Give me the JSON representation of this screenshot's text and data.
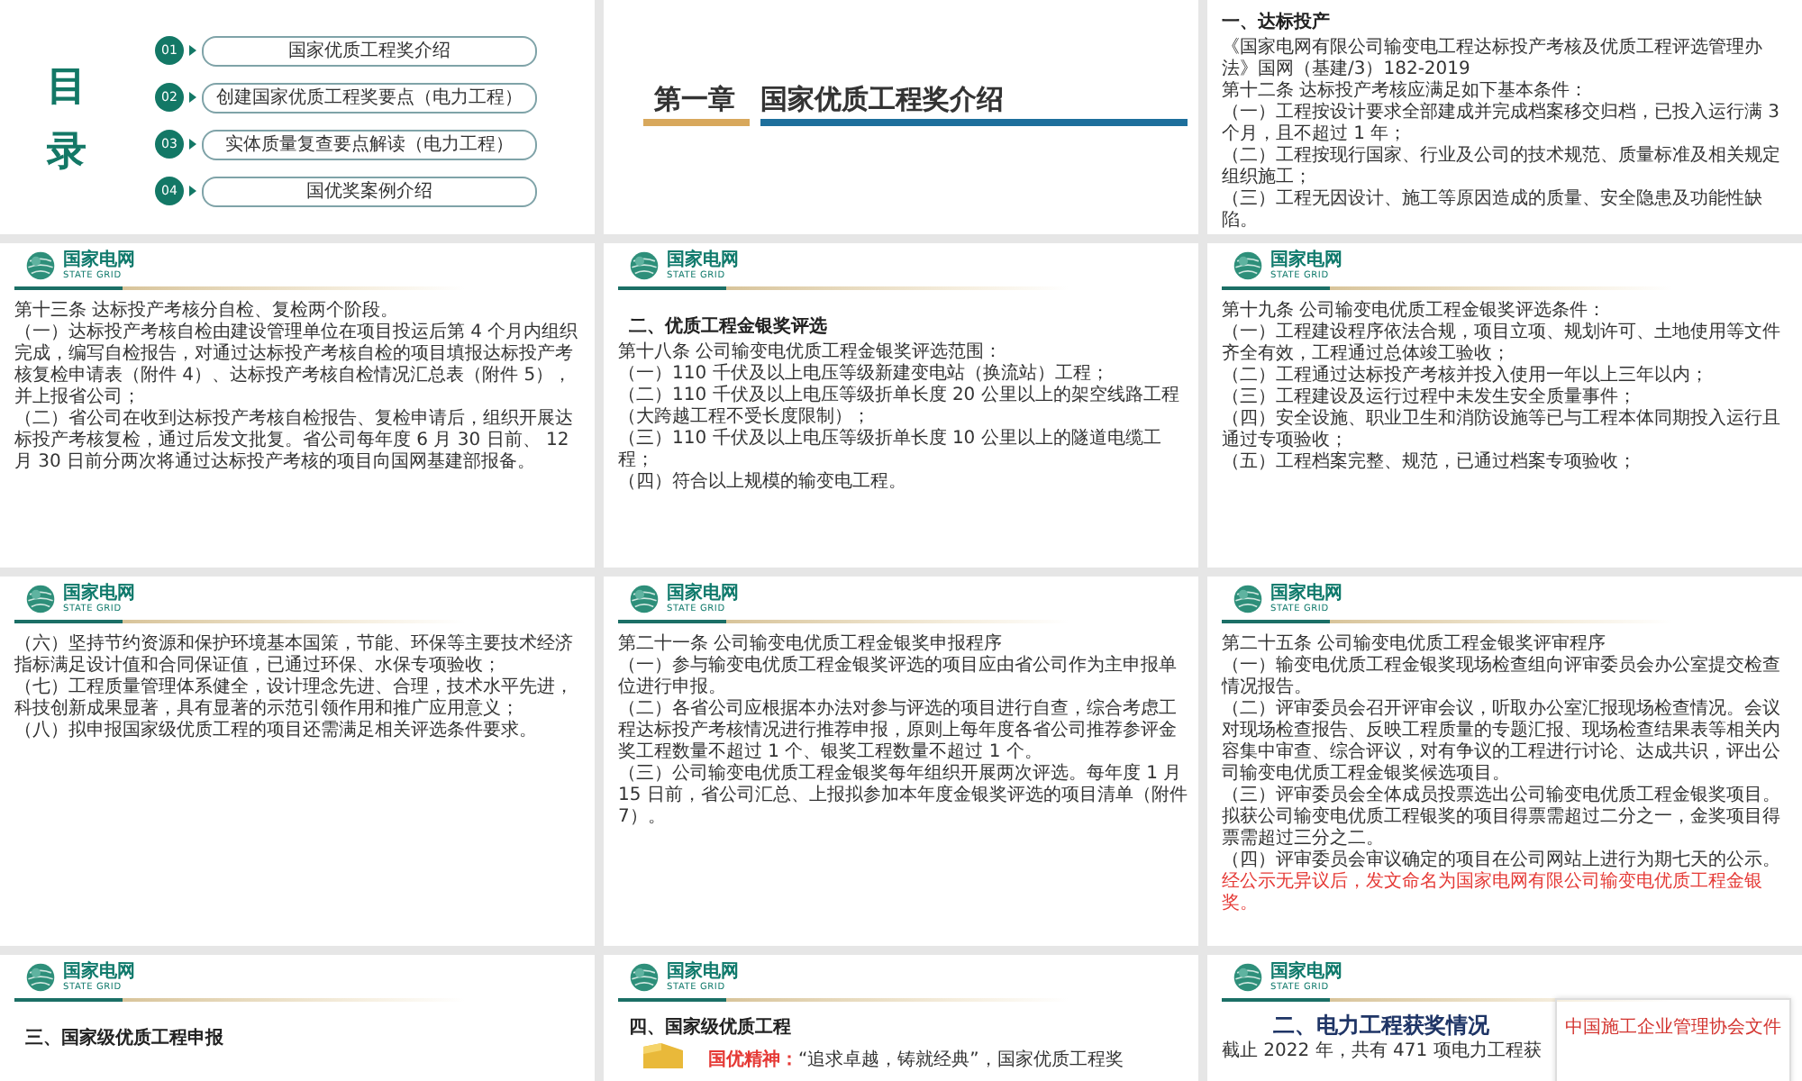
{
  "slides": [
    {
      "kind": "toc",
      "heading": [
        "目",
        "录"
      ],
      "items": [
        {
          "number": "01",
          "label": "国家优质工程奖介绍"
        },
        {
          "number": "02",
          "label": "创建国家优质工程奖要点（电力工程）"
        },
        {
          "number": "03",
          "label": "实体质量复查要点解读（电力工程）"
        },
        {
          "number": "04",
          "label": "国优奖案例介绍"
        }
      ]
    },
    {
      "kind": "chapter",
      "chapter": "第一章",
      "title": "国家优质工程奖介绍"
    },
    {
      "kind": "text",
      "heading": "一、达标投产",
      "paragraphs": [
        {
          "text": "《国家电网有限公司输变电工程达标投产考核及优质工程评选管理办法》国网（基建/3）182-2019"
        },
        {
          "text": "第十二条 达标投产考核应满足如下基本条件："
        },
        {
          "text": "（一）工程按设计要求全部建成并完成档案移交归档，已投入运行满 3 个月，且不超过 1 年；"
        },
        {
          "text": "（二）工程按现行国家、行业及公司的技术规范、质量标准及相关规定组织施工；"
        },
        {
          "text": "（三）工程无因设计、施工等原因造成的质量、安全隐患及功能性缺陷。"
        }
      ]
    },
    {
      "kind": "text",
      "logo": {
        "name": "国家电网",
        "tagline": "STATE GRID"
      },
      "paragraphs": [
        {
          "text": "第十三条 达标投产考核分自检、复检两个阶段。"
        },
        {
          "text": "（一）达标投产考核自检由建设管理单位在项目投运后第 4 个月内组织完成，编写自检报告，对通过达标投产考核自检的项目填报达标投产考核复检申请表（附件 4）、达标投产考核自检情况汇总表（附件 5），并上报省公司；"
        },
        {
          "text": "（二）省公司在收到达标投产考核自检报告、复检申请后，组织开展达标投产考核复检，通过后发文批复。省公司每年度 6 月 30 日前、 12 月 30 日前分两次将通过达标投产考核的项目向国网基建部报备。"
        }
      ]
    },
    {
      "kind": "text",
      "logo": {
        "name": "国家电网",
        "tagline": "STATE GRID"
      },
      "heading": "二、优质工程金银奖评选",
      "paragraphs": [
        {
          "text": "第十八条 公司输变电优质工程金银奖评选范围："
        },
        {
          "text": "（一）110 千伏及以上电压等级新建变电站（换流站）工程；"
        },
        {
          "text": "（二）110 千伏及以上电压等级折单长度 20 公里以上的架空线路工程（大跨越工程不受长度限制）；"
        },
        {
          "text": "（三）110 千伏及以上电压等级折单长度 10 公里以上的隧道电缆工程；"
        },
        {
          "text": "（四）符合以上规模的输变电工程。"
        }
      ]
    },
    {
      "kind": "text",
      "logo": {
        "name": "国家电网",
        "tagline": "STATE GRID"
      },
      "paragraphs": [
        {
          "text": "第十九条 公司输变电优质工程金银奖评选条件："
        },
        {
          "text": "（一）工程建设程序依法合规，项目立项、规划许可、土地使用等文件齐全有效，工程通过总体竣工验收；"
        },
        {
          "text": "（二）工程通过达标投产考核并投入使用一年以上三年以内；"
        },
        {
          "text": "（三）工程建设及运行过程中未发生安全质量事件；"
        },
        {
          "text": "（四）安全设施、职业卫生和消防设施等已与工程本体同期投入运行且通过专项验收；"
        },
        {
          "text": "（五）工程档案完整、规范，已通过档案专项验收；"
        }
      ]
    },
    {
      "kind": "text",
      "logo": {
        "name": "国家电网",
        "tagline": "STATE GRID"
      },
      "paragraphs": [
        {
          "text": "（六）坚持节约资源和保护环境基本国策，节能、环保等主要技术经济指标满足设计值和合同保证值，已通过环保、水保专项验收；"
        },
        {
          "text": "（七）工程质量管理体系健全，设计理念先进、合理，技术水平先进，科技创新成果显著，具有显著的示范引领作用和推广应用意义；"
        },
        {
          "text": "（八）拟申报国家级优质工程的项目还需满足相关评选条件要求。"
        }
      ]
    },
    {
      "kind": "text",
      "logo": {
        "name": "国家电网",
        "tagline": "STATE GRID"
      },
      "paragraphs": [
        {
          "text": "第二十一条 公司输变电优质工程金银奖申报程序"
        },
        {
          "text": "（一）参与输变电优质工程金银奖评选的项目应由省公司作为主申报单位进行申报。"
        },
        {
          "text": "（二）各省公司应根据本办法对参与评选的项目进行自查，综合考虑工程达标投产考核情况进行推荐申报，原则上每年度各省公司推荐参评金奖工程数量不超过 1 个、银奖工程数量不超过 1 个。"
        },
        {
          "text": "（三）公司输变电优质工程金银奖每年组织开展两次评选。每年度 1 月 15 日前，省公司汇总、上报拟参加本年度金银奖评选的项目清单（附件 7）。"
        }
      ]
    },
    {
      "kind": "text",
      "logo": {
        "name": "国家电网",
        "tagline": "STATE GRID"
      },
      "paragraphs": [
        {
          "text": "第二十五条 公司输变电优质工程金银奖评审程序"
        },
        {
          "text": "（一）输变电优质工程金银奖现场检查组向评审委员会办公室提交检查情况报告。"
        },
        {
          "text": "（二）评审委员会召开评审会议，听取办公室汇报现场检查情况。会议对现场检查报告、反映工程质量的专题汇报、现场检查结果表等相关内容集中审查、综合评议，对有争议的工程进行讨论、达成共识，评出公司输变电优质工程金银奖候选项目。"
        },
        {
          "text": "（三）评审委员会全体成员投票选出公司输变电优质工程金银奖项目。拟获公司输变电优质工程银奖的项目得票需超过二分之一，金奖项目得票需超过三分之二。"
        },
        {
          "text": "（四）评审委员会审议确定的项目在公司网站上进行为期七天的公示。",
          "red_tail": "经公示无异议后，发文命名为国家电网有限公司输变电优质工程金银奖。"
        }
      ]
    },
    {
      "kind": "text",
      "logo": {
        "name": "国家电网",
        "tagline": "STATE GRID"
      },
      "heading": "三、国家级优质工程申报"
    },
    {
      "kind": "feature",
      "logo": {
        "name": "国家电网",
        "tagline": "STATE GRID"
      },
      "heading": "四、国家级优质工程",
      "label": "国优精神：",
      "text": "“追求卓越，铸就经典”，国家优质工程奖"
    },
    {
      "kind": "awards",
      "logo": {
        "name": "国家电网",
        "tagline": "STATE GRID"
      },
      "heading": "二、电力工程获奖情况",
      "text": "截止 2022 年，共有 471 项电力工程获",
      "document_title": "中国施工企业管理协会文件"
    }
  ]
}
